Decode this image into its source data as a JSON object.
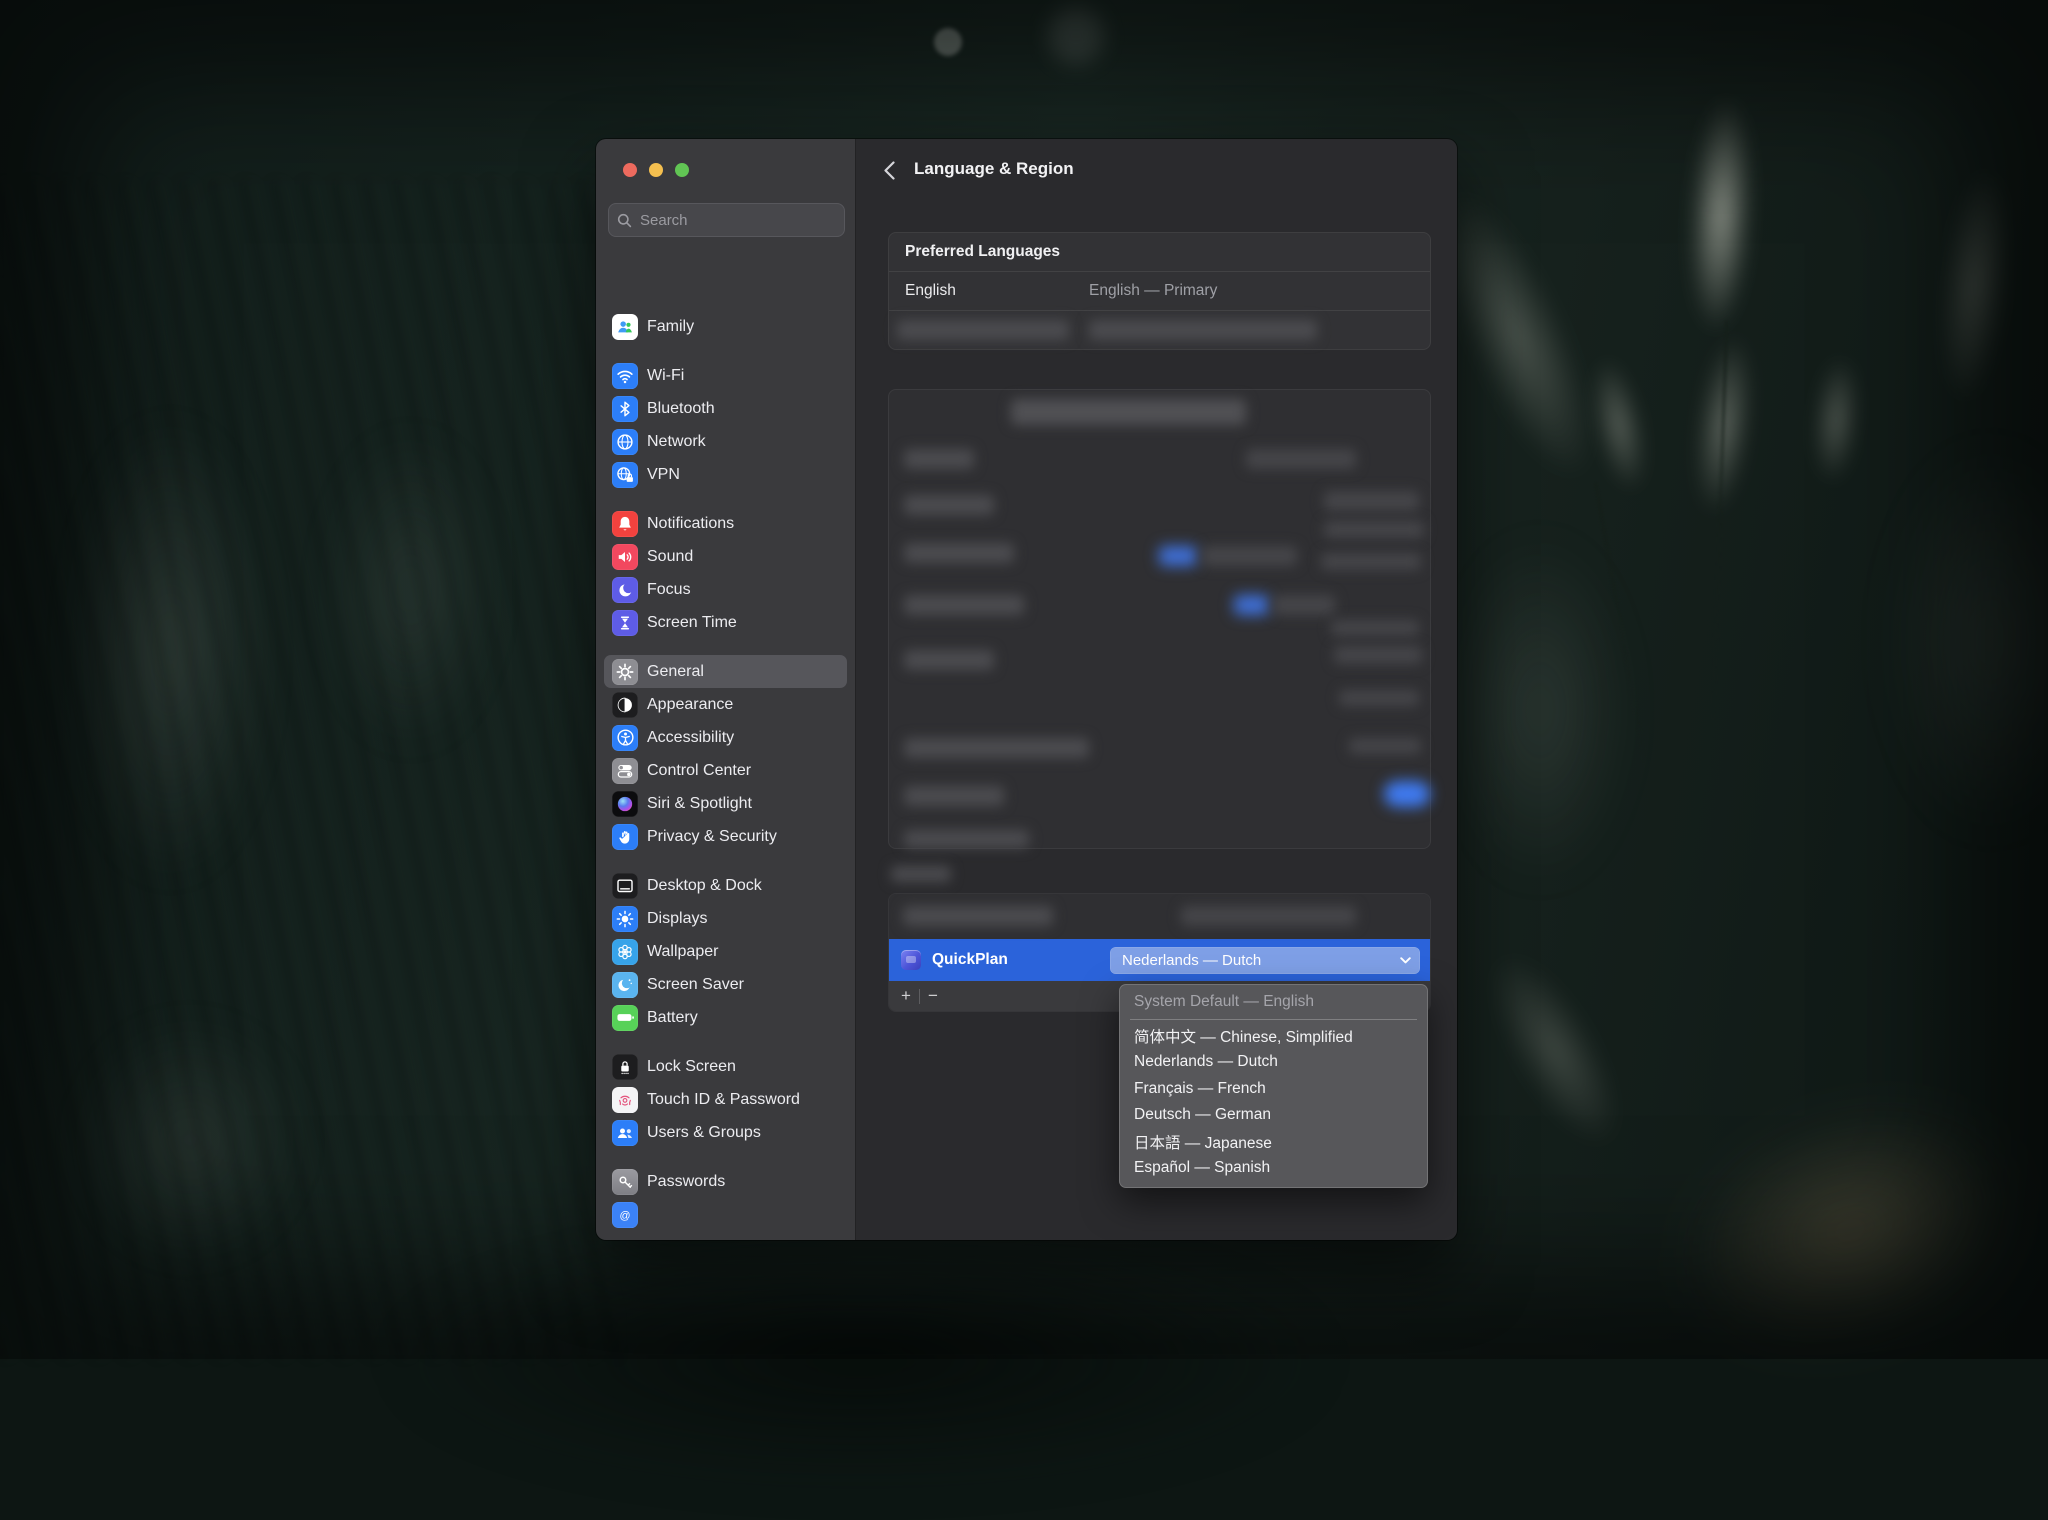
{
  "sidebar": {
    "search_placeholder": "Search",
    "groups": [
      {
        "items": [
          {
            "label": "Family",
            "icon": "family-icon"
          }
        ]
      },
      {
        "items": [
          {
            "label": "Wi-Fi",
            "icon": "wifi-icon"
          },
          {
            "label": "Bluetooth",
            "icon": "bluetooth-icon"
          },
          {
            "label": "Network",
            "icon": "globe-icon"
          },
          {
            "label": "VPN",
            "icon": "globe-lock-icon"
          }
        ]
      },
      {
        "items": [
          {
            "label": "Notifications",
            "icon": "bell-icon"
          },
          {
            "label": "Sound",
            "icon": "speaker-icon"
          },
          {
            "label": "Focus",
            "icon": "moon-icon"
          },
          {
            "label": "Screen Time",
            "icon": "hourglass-icon"
          }
        ]
      },
      {
        "items": [
          {
            "label": "General",
            "icon": "gear-icon",
            "selected": true
          },
          {
            "label": "Appearance",
            "icon": "appearance-icon"
          },
          {
            "label": "Accessibility",
            "icon": "accessibility-icon"
          },
          {
            "label": "Control Center",
            "icon": "toggles-icon"
          },
          {
            "label": "Siri & Spotlight",
            "icon": "siri-orb-icon"
          },
          {
            "label": "Privacy & Security",
            "icon": "hand-icon"
          }
        ]
      },
      {
        "items": [
          {
            "label": "Desktop & Dock",
            "icon": "desktop-dock-icon"
          },
          {
            "label": "Displays",
            "icon": "sun-icon"
          },
          {
            "label": "Wallpaper",
            "icon": "flower-icon"
          },
          {
            "label": "Screen Saver",
            "icon": "crescent-stars-icon"
          },
          {
            "label": "Battery",
            "icon": "battery-icon"
          }
        ]
      },
      {
        "items": [
          {
            "label": "Lock Screen",
            "icon": "lock-icon"
          },
          {
            "label": "Touch ID & Password",
            "icon": "fingerprint-icon"
          },
          {
            "label": "Users & Groups",
            "icon": "two-users-icon"
          }
        ]
      },
      {
        "items": [
          {
            "label": "Passwords",
            "icon": "key-icon"
          },
          {
            "label": "",
            "icon": "internet-accounts-icon"
          }
        ]
      }
    ]
  },
  "main": {
    "title": "Language & Region",
    "preferred_languages": {
      "header": "Preferred Languages",
      "rows": [
        {
          "language": "English",
          "status": "English — Primary"
        }
      ]
    },
    "app_language_row": {
      "app": "QuickPlan",
      "selected_language": "Nederlands — Dutch"
    },
    "list_controls": {
      "add": "+",
      "remove": "−"
    },
    "language_menu": {
      "items": [
        {
          "label": "System Default — English",
          "enabled": false
        },
        {
          "label": "简体中文 — Chinese, Simplified",
          "enabled": true
        },
        {
          "label": "Nederlands — Dutch",
          "enabled": true
        },
        {
          "label": "Français — French",
          "enabled": true
        },
        {
          "label": "Deutsch — German",
          "enabled": true
        },
        {
          "label": "日本語 — Japanese",
          "enabled": true
        },
        {
          "label": "Español — Spanish",
          "enabled": true
        }
      ]
    }
  },
  "colors": {
    "selection_blue": "#2b63da",
    "select_pill_blue": "#7e9fe6",
    "sidebar_selected": "#56565b",
    "accent_blue": "#2c7ef8"
  }
}
